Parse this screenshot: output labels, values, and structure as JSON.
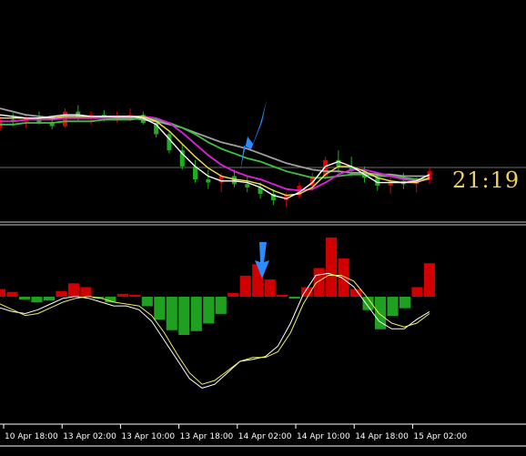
{
  "clock": "21:19",
  "colors": {
    "background": "#000000",
    "bull": "#e00000",
    "bear": "#1fae1f",
    "ma_fast": "#ffffff",
    "ma_yellow": "#f5e050",
    "ma_magenta": "#e020e0",
    "ma_green": "#40c040",
    "ma_gray": "#a0a0a0",
    "osc_pos": "#d00000",
    "osc_neg": "#20a020",
    "signal_white": "#ffffff",
    "signal_yellow": "#f0f060",
    "arrow": "#2a8cff"
  },
  "chart_data": [
    {
      "type": "line",
      "panel": "price",
      "candles": [
        {
          "t": 0,
          "o": 54,
          "h": 62,
          "l": 52,
          "c": 59
        },
        {
          "t": 1,
          "o": 59,
          "h": 63,
          "l": 55,
          "c": 58
        },
        {
          "t": 2,
          "o": 58,
          "h": 62,
          "l": 54,
          "c": 60
        },
        {
          "t": 3,
          "o": 60,
          "h": 64,
          "l": 56,
          "c": 57
        },
        {
          "t": 4,
          "o": 57,
          "h": 61,
          "l": 53,
          "c": 55
        },
        {
          "t": 5,
          "o": 55,
          "h": 66,
          "l": 54,
          "c": 64
        },
        {
          "t": 6,
          "o": 64,
          "h": 68,
          "l": 58,
          "c": 60
        },
        {
          "t": 7,
          "o": 60,
          "h": 64,
          "l": 56,
          "c": 62
        },
        {
          "t": 8,
          "o": 62,
          "h": 65,
          "l": 58,
          "c": 60
        },
        {
          "t": 9,
          "o": 60,
          "h": 64,
          "l": 57,
          "c": 61
        },
        {
          "t": 10,
          "o": 61,
          "h": 66,
          "l": 58,
          "c": 62
        },
        {
          "t": 11,
          "o": 62,
          "h": 64,
          "l": 56,
          "c": 57
        },
        {
          "t": 12,
          "o": 57,
          "h": 60,
          "l": 48,
          "c": 50
        },
        {
          "t": 13,
          "o": 50,
          "h": 52,
          "l": 38,
          "c": 40
        },
        {
          "t": 14,
          "o": 40,
          "h": 44,
          "l": 28,
          "c": 30
        },
        {
          "t": 15,
          "o": 30,
          "h": 34,
          "l": 20,
          "c": 22
        },
        {
          "t": 16,
          "o": 22,
          "h": 28,
          "l": 16,
          "c": 20
        },
        {
          "t": 17,
          "o": 20,
          "h": 26,
          "l": 14,
          "c": 24
        },
        {
          "t": 18,
          "o": 24,
          "h": 28,
          "l": 17,
          "c": 19
        },
        {
          "t": 19,
          "o": 19,
          "h": 24,
          "l": 14,
          "c": 17
        },
        {
          "t": 20,
          "o": 17,
          "h": 20,
          "l": 10,
          "c": 13
        },
        {
          "t": 21,
          "o": 13,
          "h": 16,
          "l": 6,
          "c": 9
        },
        {
          "t": 22,
          "o": 9,
          "h": 14,
          "l": 5,
          "c": 12
        },
        {
          "t": 23,
          "o": 12,
          "h": 20,
          "l": 10,
          "c": 18
        },
        {
          "t": 24,
          "o": 18,
          "h": 26,
          "l": 15,
          "c": 24
        },
        {
          "t": 25,
          "o": 24,
          "h": 36,
          "l": 22,
          "c": 34
        },
        {
          "t": 26,
          "o": 34,
          "h": 40,
          "l": 26,
          "c": 30
        },
        {
          "t": 27,
          "o": 30,
          "h": 36,
          "l": 24,
          "c": 27
        },
        {
          "t": 28,
          "o": 27,
          "h": 30,
          "l": 20,
          "c": 23
        },
        {
          "t": 29,
          "o": 23,
          "h": 26,
          "l": 15,
          "c": 18
        },
        {
          "t": 30,
          "o": 18,
          "h": 24,
          "l": 13,
          "c": 21
        },
        {
          "t": 31,
          "o": 21,
          "h": 26,
          "l": 16,
          "c": 19
        },
        {
          "t": 32,
          "o": 19,
          "h": 24,
          "l": 14,
          "c": 22
        },
        {
          "t": 33,
          "o": 22,
          "h": 30,
          "l": 19,
          "c": 27
        }
      ],
      "series": [
        {
          "values": [
            62,
            61,
            60,
            60,
            61,
            62,
            62,
            61,
            61,
            61,
            61,
            60,
            56,
            47,
            38,
            30,
            24,
            21,
            21,
            20,
            17,
            12,
            10,
            14,
            20,
            30,
            33,
            30,
            25,
            20,
            20,
            20,
            21,
            25
          ]
        },
        {
          "values": [
            60,
            60,
            60,
            60,
            60,
            61,
            61,
            61,
            61,
            61,
            61,
            61,
            58,
            52,
            44,
            36,
            29,
            24,
            22,
            21,
            19,
            15,
            12,
            13,
            17,
            25,
            30,
            30,
            27,
            23,
            21,
            20,
            20,
            23
          ]
        },
        {
          "values": [
            58,
            58,
            59,
            59,
            59,
            60,
            60,
            60,
            60,
            61,
            61,
            61,
            60,
            57,
            51,
            44,
            37,
            31,
            27,
            24,
            22,
            19,
            16,
            15,
            16,
            20,
            25,
            28,
            28,
            26,
            24,
            22,
            21,
            22
          ]
        },
        {
          "values": [
            56,
            56,
            57,
            57,
            57,
            58,
            58,
            58,
            59,
            59,
            59,
            60,
            59,
            57,
            54,
            50,
            45,
            41,
            38,
            35,
            33,
            30,
            27,
            25,
            23,
            23,
            24,
            25,
            25,
            24,
            24,
            23,
            22,
            22
          ]
        },
        {
          "values": [
            66,
            64,
            62,
            61,
            60,
            60,
            60,
            60,
            60,
            60,
            60,
            59,
            58,
            56,
            54,
            51,
            48,
            45,
            43,
            41,
            38,
            35,
            32,
            30,
            28,
            27,
            27,
            26,
            26,
            25,
            25,
            24,
            24,
            24
          ]
        }
      ]
    },
    {
      "type": "bar",
      "panel": "oscillator",
      "x": [
        "10 Apr 18:00",
        "13 Apr 02:00",
        "13 Apr 10:00",
        "13 Apr 18:00",
        "14 Apr 02:00",
        "14 Apr 10:00",
        "14 Apr 18:00",
        "15 Apr 02:00"
      ],
      "values": [
        8,
        5,
        -3,
        -6,
        -4,
        6,
        14,
        10,
        -2,
        -6,
        3,
        2,
        -10,
        -24,
        -35,
        -40,
        -36,
        -28,
        -18,
        4,
        22,
        34,
        18,
        2,
        -2,
        10,
        30,
        62,
        40,
        8,
        -14,
        -34,
        -20,
        -12,
        10,
        35
      ],
      "series": [
        {
          "values": [
            -4,
            -8,
            -10,
            -6,
            0,
            6,
            8,
            6,
            2,
            -2,
            -2,
            -6,
            -18,
            -38,
            -58,
            -78,
            -88,
            -84,
            -72,
            -60,
            -58,
            -55,
            -44,
            -20,
            10,
            30,
            32,
            28,
            18,
            0,
            -18,
            -26,
            -26,
            -16,
            -8
          ]
        },
        {
          "values": [
            0,
            -6,
            -12,
            -10,
            -4,
            2,
            6,
            8,
            6,
            2,
            0,
            -2,
            -12,
            -30,
            -52,
            -72,
            -84,
            -80,
            -70,
            -60,
            -56,
            -56,
            -50,
            -30,
            0,
            22,
            30,
            30,
            24,
            8,
            -10,
            -20,
            -24,
            -20,
            -10
          ]
        }
      ]
    }
  ]
}
